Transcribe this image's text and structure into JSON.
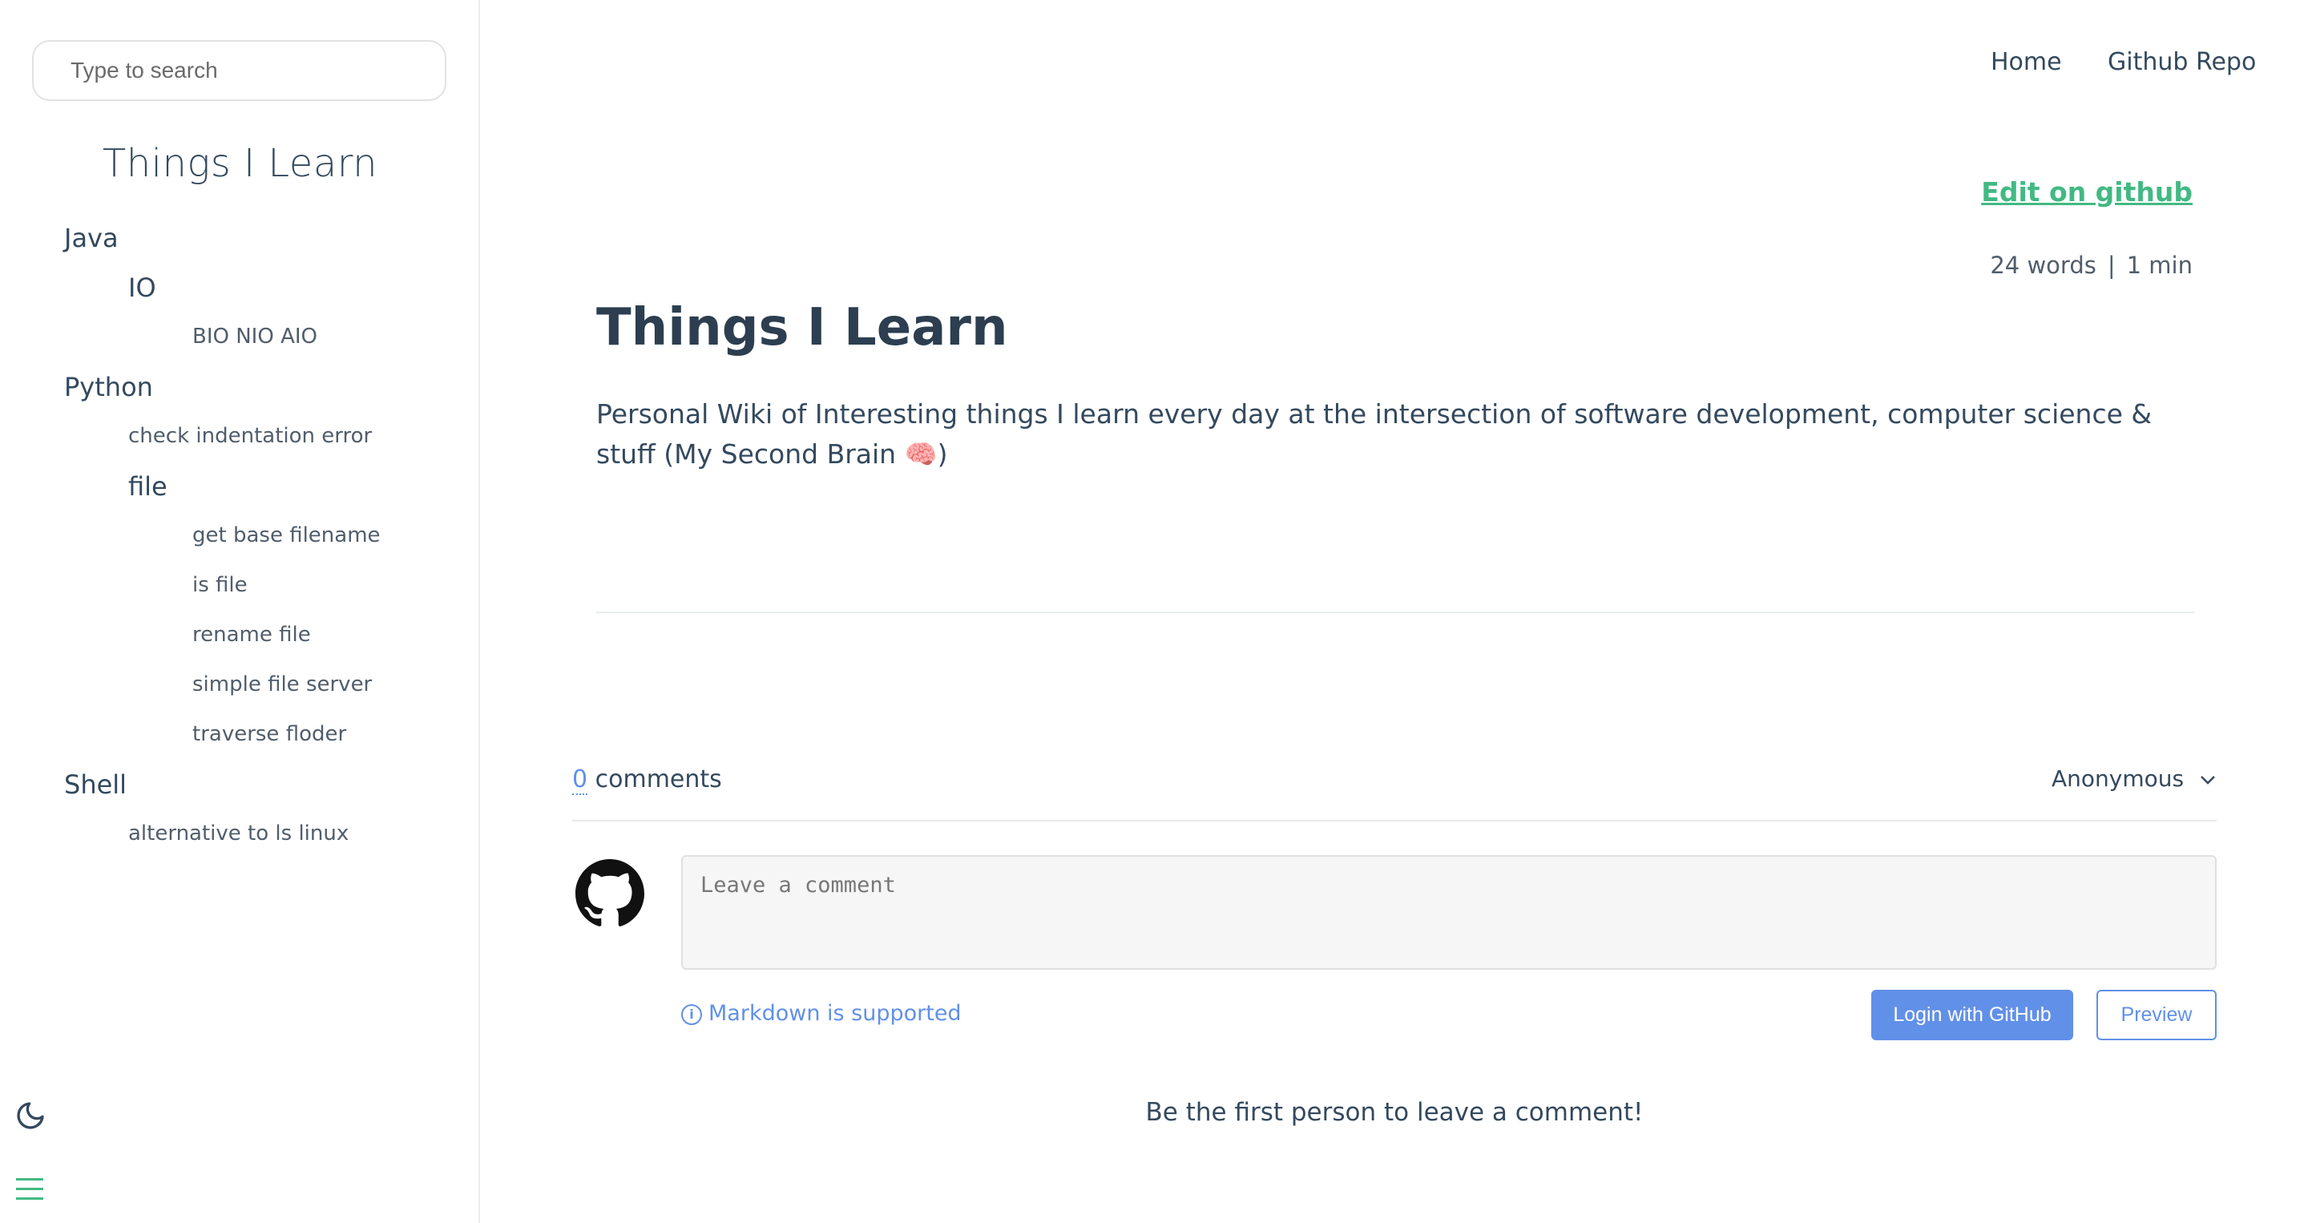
{
  "sidebar": {
    "search_placeholder": "Type to search",
    "app_name": "Things I Learn",
    "nav": {
      "java": "Java",
      "java_io": "IO",
      "java_io_bio": "BIO NIO AIO",
      "python": "Python",
      "python_check_indentation": "check indentation error",
      "python_file": "file",
      "python_file_base_name": "get base filename",
      "python_file_is_file": "is file",
      "python_file_rename": "rename file",
      "python_file_server": "simple file server",
      "python_file_traverse": "traverse floder",
      "shell": "Shell",
      "shell_ls_alt": "alternative to ls linux"
    }
  },
  "topnav": {
    "home": "Home",
    "github_repo": "Github Repo"
  },
  "content": {
    "edit_link": "Edit on github",
    "words": "24 words",
    "separator": "|",
    "read_time": "1 min",
    "title": "Things I Learn",
    "intro": "Personal Wiki of Interesting things I learn every day at the intersection of software development, computer science & stuff (My Second Brain 🧠)"
  },
  "comments": {
    "count": "0",
    "label": "comments",
    "user": "Anonymous",
    "placeholder": "Leave a comment",
    "markdown_note": "Markdown is supported",
    "login_button": "Login with GitHub",
    "preview_button": "Preview",
    "empty_message": "Be the first person to leave a comment!"
  },
  "colors": {
    "accent": "#42b983",
    "link_blue": "#6190e8",
    "text": "#34495e"
  },
  "icons": {
    "theme": "moon-icon",
    "menu": "hamburger-menu-icon",
    "avatar": "github-logo-icon",
    "dropdown": "chevron-down-icon",
    "info": "info-icon"
  }
}
